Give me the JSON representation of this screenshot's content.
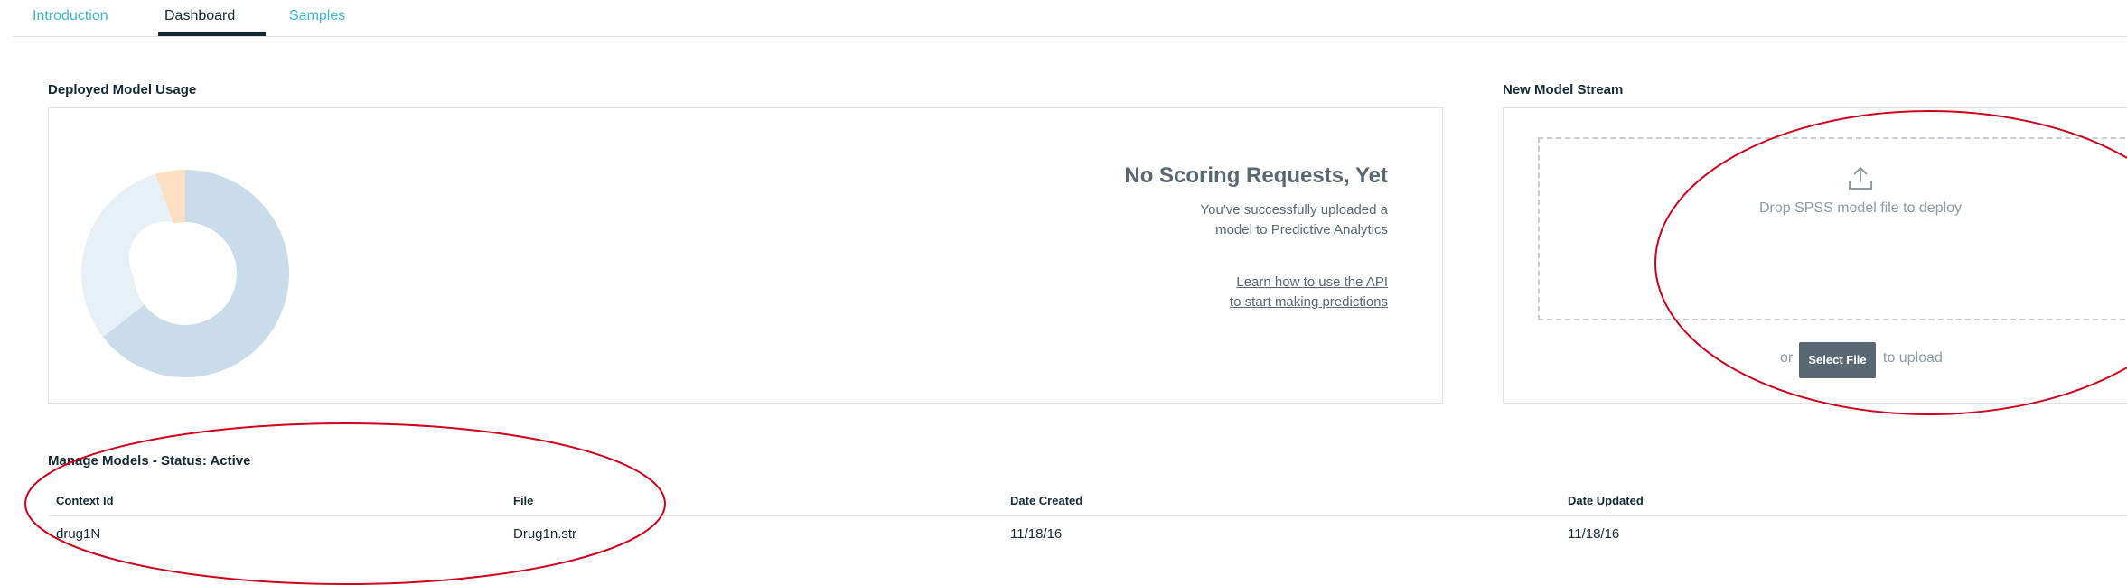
{
  "tabs": [
    {
      "label": "Introduction",
      "active": false
    },
    {
      "label": "Dashboard",
      "active": true
    },
    {
      "label": "Samples",
      "active": false
    }
  ],
  "usage": {
    "title": "Deployed Model Usage",
    "empty_title": "No Scoring Requests, Yet",
    "empty_line1": "You've successfully uploaded a",
    "empty_line2": "model to Predictive Analytics",
    "link_line1": "Learn how to use the API",
    "link_line2": "to start making predictions",
    "donut_colors": [
      "#c8dde9",
      "#e8f0f7",
      "#fcdfc0"
    ]
  },
  "stream": {
    "title": "New Model Stream",
    "drop_text": "Drop SPSS model file to deploy",
    "upload_icon": "upload-icon",
    "or_text": "or",
    "select_label": "Select File",
    "to_upload_text": "to upload"
  },
  "models": {
    "title": "Manage Models - Status: Active",
    "columns": [
      "Context Id",
      "File",
      "Date Created",
      "Date Updated"
    ],
    "rows": [
      [
        "drug1N",
        "Drug1n.str",
        "11/18/16",
        "11/18/16"
      ]
    ]
  },
  "colors": {
    "link": "#3bb6d3",
    "annotation": "#d0021b",
    "button": "#5a6872"
  }
}
